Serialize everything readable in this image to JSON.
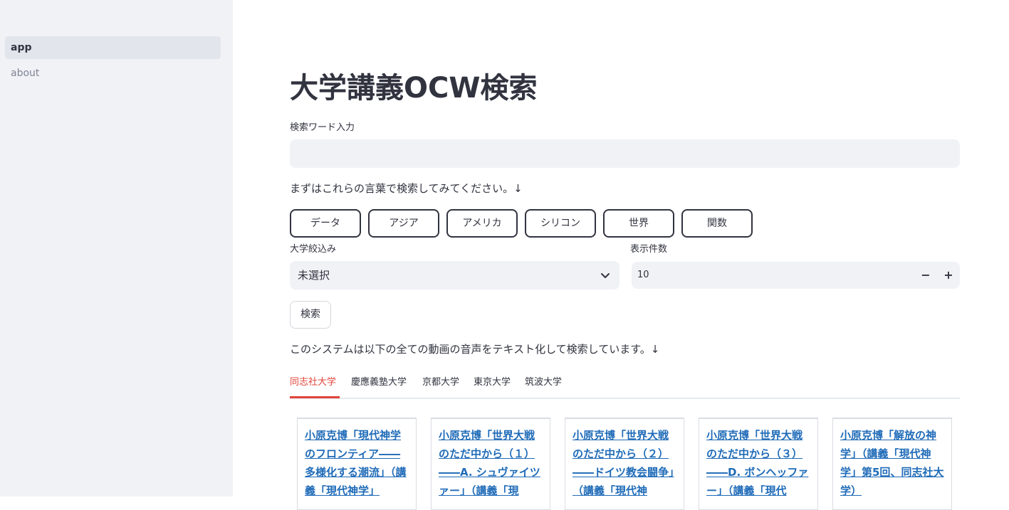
{
  "sidebar": {
    "items": [
      {
        "label": "app",
        "active": true
      },
      {
        "label": "about",
        "active": false
      }
    ]
  },
  "main": {
    "title": "大学講義OCW検索",
    "search": {
      "label": "検索ワード入力",
      "value": "",
      "placeholder": ""
    },
    "suggest_text": "まずはこれらの言葉で検索してみてください。↓",
    "chips": [
      "データ",
      "アジア",
      "アメリカ",
      "シリコン",
      "世界",
      "関数"
    ],
    "university_filter": {
      "label": "大学絞込み",
      "selected": "未選択"
    },
    "count": {
      "label": "表示件数",
      "value": "10",
      "minus": "−",
      "plus": "+"
    },
    "search_button": "検索",
    "info_text": "このシステムは以下の全ての動画の音声をテキスト化して検索しています。↓",
    "tabs": [
      "同志社大学",
      "慶應義塾大学",
      "京都大学",
      "東京大学",
      "筑波大学"
    ],
    "cards": [
      "小原克博「現代神学のフロンティア――多様化する潮流」（講義「現代神学」",
      "小原克博「世界大戦のただ中から（１）――A. シュヴァイツァー」（講義「現",
      "小原克博「世界大戦のただ中から（２）――ドイツ教会闘争」（講義「現代神",
      "小原克博「世界大戦のただ中から（３）――D. ボンヘッファー」（講義「現代",
      "小原克博「解放の神学」（講義「現代神学」第5回、同志社大学）"
    ]
  },
  "colors": {
    "accent": "#e2443a",
    "link": "#1f6bb8",
    "sidebar_bg": "#f0f2f6"
  }
}
